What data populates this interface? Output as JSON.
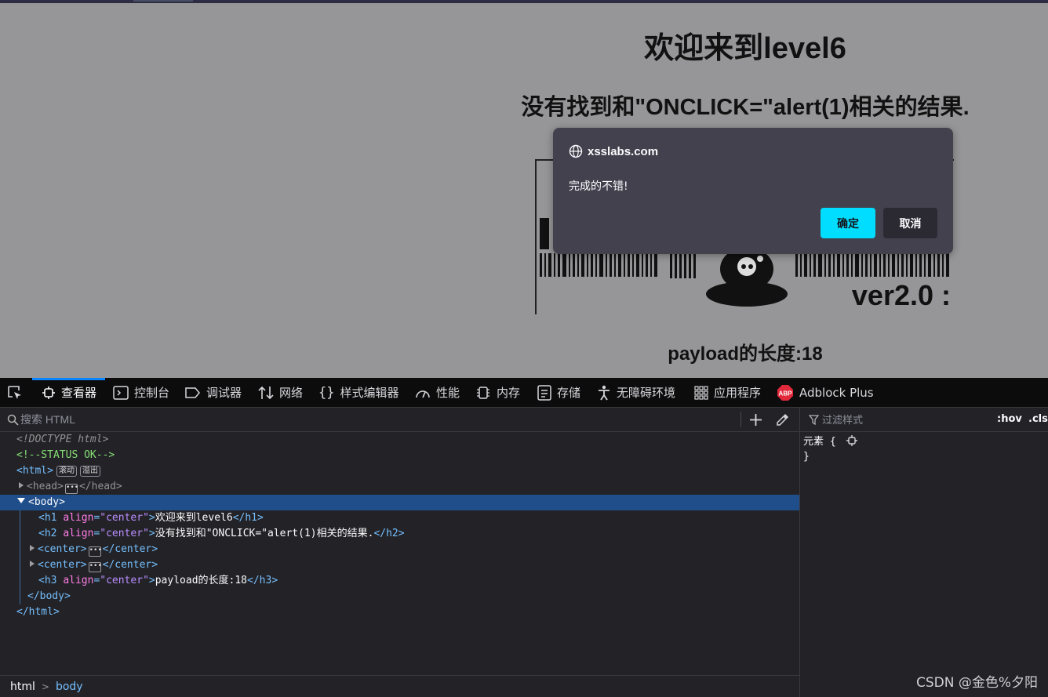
{
  "page": {
    "h1": "欢迎来到level6",
    "h2": "没有找到和\"ONCLICK=\"alert(1)相关的结果.",
    "h3": "payload的长度:18",
    "image_text": "ver2.0 :"
  },
  "alert": {
    "origin": "xsslabs.com",
    "message": "完成的不错!",
    "ok_label": "确定",
    "cancel_label": "取消"
  },
  "devtools": {
    "tabs": [
      {
        "label": "查看器",
        "icon": "inspector-icon"
      },
      {
        "label": "控制台",
        "icon": "console-icon"
      },
      {
        "label": "调试器",
        "icon": "debugger-icon"
      },
      {
        "label": "网络",
        "icon": "network-icon"
      },
      {
        "label": "样式编辑器",
        "icon": "style-editor-icon"
      },
      {
        "label": "性能",
        "icon": "performance-icon"
      },
      {
        "label": "内存",
        "icon": "memory-icon"
      },
      {
        "label": "存储",
        "icon": "storage-icon"
      },
      {
        "label": "无障碍环境",
        "icon": "accessibility-icon"
      },
      {
        "label": "应用程序",
        "icon": "application-icon"
      },
      {
        "label": "Adblock Plus",
        "icon": "adblock-plus-icon"
      }
    ],
    "search_placeholder": "搜索 HTML",
    "markup": {
      "doctype": "<!DOCTYPE html>",
      "comment": "<!--STATUS OK-->",
      "html_open": "<html>",
      "badge_scroll": "滚动",
      "badge_overflow": "溢出",
      "head_open": "<head>",
      "head_close": "</head>",
      "body_open": "<body>",
      "h1_open": "<h1",
      "h2_open": "<h2",
      "h3_open": "<h3",
      "attr_align": "align",
      "eq": "=",
      "val_center": "\"center\"",
      "gt": ">",
      "h1_text": "欢迎来到level6",
      "h2_text": "没有找到和\"ONCLICK=\"alert(1)相关的结果.",
      "h3_text": "payload的长度:18",
      "h1_close": "</h1>",
      "h2_close": "</h2>",
      "h3_close": "</h3>",
      "center_open": "<center>",
      "center_close": "</center>",
      "body_close": "</body>",
      "html_close": "</html>"
    },
    "breadcrumbs": [
      "html",
      "body"
    ],
    "rules": {
      "filter_placeholder": "过滤样式",
      "hov": ":hov",
      "cls": ".cls",
      "element_selector": "元素 {",
      "close_brace": "}"
    }
  },
  "watermark": "CSDN @金色%夕阳",
  "colors": {
    "accent": "#00ddff",
    "selection": "#204e8a",
    "tab_active": "#0a84ff"
  }
}
